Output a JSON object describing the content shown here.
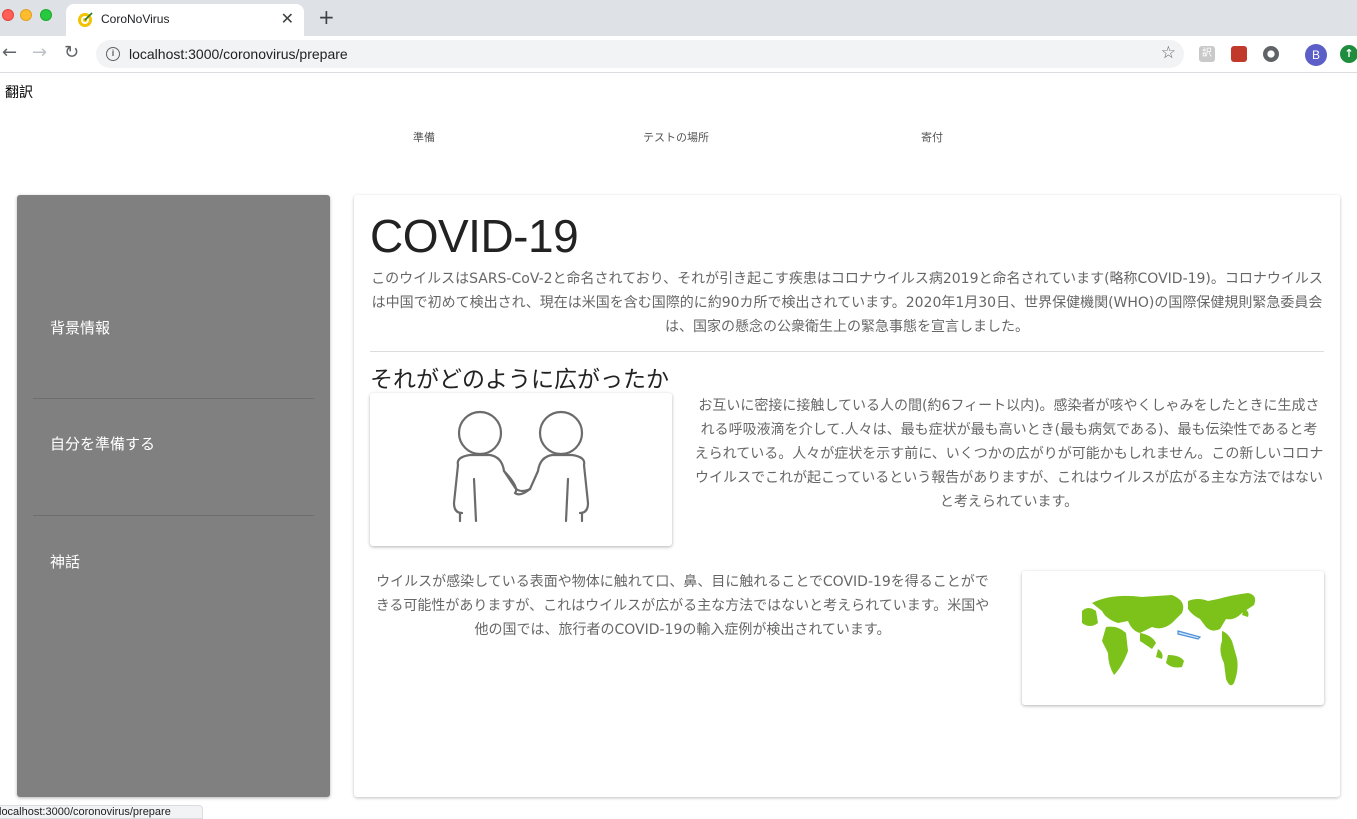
{
  "browser": {
    "tab_title": "CoroNoVirus",
    "tab_close": "✕",
    "new_tab": "+",
    "url": "localhost:3000/coronovirus/prepare",
    "info_glyph": "i",
    "back_glyph": "←",
    "forward_glyph": "→",
    "reload_glyph": "↻",
    "star_glyph": "☆",
    "profile_initial": "B",
    "ext_1_glyph": "訳",
    "update_glyph": "↑",
    "status_url": "localhost:3000/coronovirus/prepare"
  },
  "header": {
    "translate": "翻訳",
    "nav": [
      "準備",
      "テストの場所",
      "寄付"
    ]
  },
  "sidebar": {
    "items": [
      "背景情報",
      "自分を準備する",
      "神話"
    ]
  },
  "main": {
    "title": "COVID-19",
    "intro": "このウイルスはSARS-CoV-2と命名されており、それが引き起こす疾患はコロナウイルス病2019と命名されています(略称COVID-19)。コロナウイルスは中国で初めて検出され、現在は米国を含む国際的に約90カ所で検出されています。2020年1月30日、世界保健機関(WHO)の国際保健規則緊急委員会は、国家の懸念の公衆衛生上の緊急事態を宣言しました。",
    "subtitle": "それがどのように広がったか",
    "spread_text": "お互いに密接に接触している人の間(約6フィート以内)。感染者が咳やくしゃみをしたときに生成される呼吸液滴を介して.人々は、最も症状が最も高いとき(最も病気である)、最も伝染性であると考えられている。人々が症状を示す前に、いくつかの広がりが可能かもしれません。この新しいコロナウイルスでこれが起こっているという報告がありますが、これはウイルスが広がる主な方法ではないと考えられています。",
    "surface_text": "ウイルスが感染している表面や物体に触れて口、鼻、目に触れることでCOVID-19を得ることができる可能性がありますが、これはウイルスが広がる主な方法ではないと考えられています。米国や他の国では、旅行者のCOVID-19の輸入症例が検出されています。"
  },
  "colors": {
    "sidebar_bg": "#808080",
    "map_green": "#7cc21a",
    "body_text": "#666666"
  }
}
